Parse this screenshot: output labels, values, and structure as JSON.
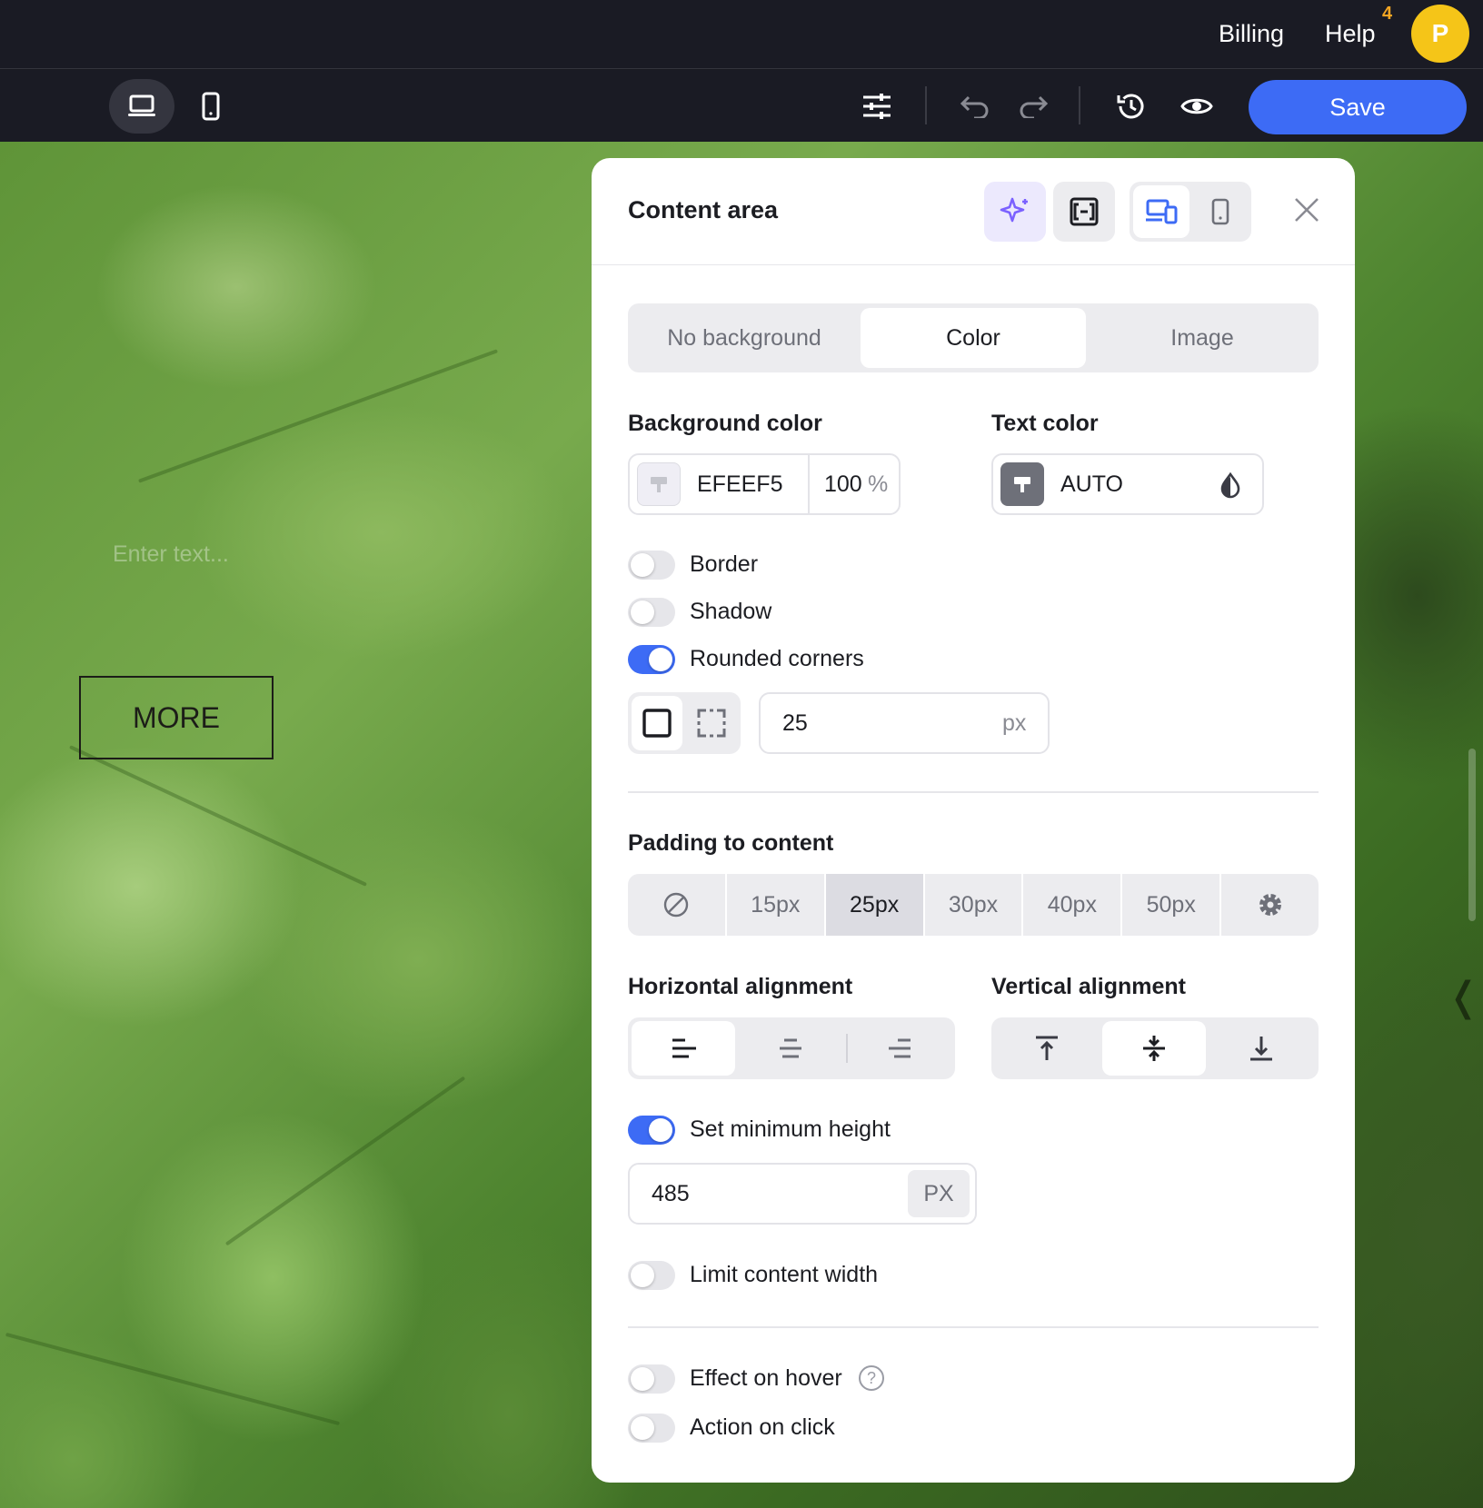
{
  "topbar": {
    "billing": "Billing",
    "help": "Help",
    "help_badge": "4",
    "avatar_letter": "P"
  },
  "toolbar": {
    "save_label": "Save",
    "icons": [
      "desktop-icon",
      "mobile-icon",
      "sliders-icon",
      "undo-icon",
      "redo-icon",
      "history-icon",
      "eye-icon"
    ]
  },
  "canvas": {
    "placeholder_text": "Enter text...",
    "more_button": "MORE"
  },
  "panel": {
    "title": "Content area",
    "background_tabs": [
      {
        "label": "No background",
        "active": false
      },
      {
        "label": "Color",
        "active": true
      },
      {
        "label": "Image",
        "active": false
      }
    ],
    "background_color": {
      "label": "Background color",
      "hex": "EFEEF5",
      "opacity": "100",
      "opacity_unit": "%"
    },
    "text_color": {
      "label": "Text color",
      "value": "AUTO"
    },
    "toggles": {
      "border": {
        "label": "Border",
        "on": false
      },
      "shadow": {
        "label": "Shadow",
        "on": false
      },
      "rounded": {
        "label": "Rounded corners",
        "on": true
      },
      "min_height": {
        "label": "Set minimum height",
        "on": true
      },
      "limit_width": {
        "label": "Limit content width",
        "on": false
      },
      "hover": {
        "label": "Effect on hover",
        "on": false
      },
      "click": {
        "label": "Action on click",
        "on": false
      }
    },
    "radius": {
      "value": "25",
      "unit": "px"
    },
    "padding": {
      "label": "Padding to content",
      "options": [
        "15px",
        "25px",
        "30px",
        "40px",
        "50px"
      ],
      "selected": "25px"
    },
    "horizontal_alignment": {
      "label": "Horizontal alignment",
      "selected": "left"
    },
    "vertical_alignment": {
      "label": "Vertical alignment",
      "selected": "middle"
    },
    "min_height": {
      "value": "485",
      "unit": "PX"
    },
    "help_glyph": "?"
  },
  "colors": {
    "accent": "#3d6bf5",
    "avatar": "#f5c518",
    "badge": "#f5a623",
    "ai_tint": "#ece9fd"
  }
}
